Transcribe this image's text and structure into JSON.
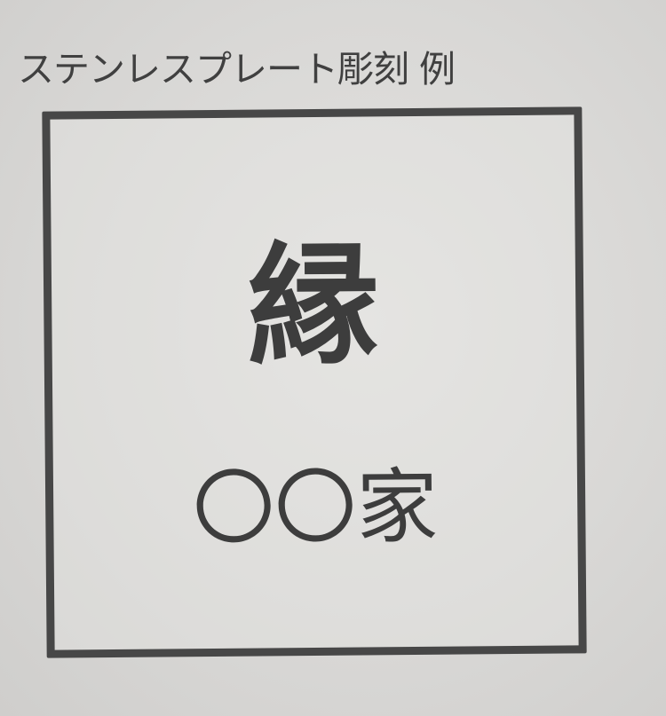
{
  "caption": "ステンレスプレート彫刻 例",
  "plate": {
    "main_character": "縁",
    "family_line": "〇〇家"
  }
}
